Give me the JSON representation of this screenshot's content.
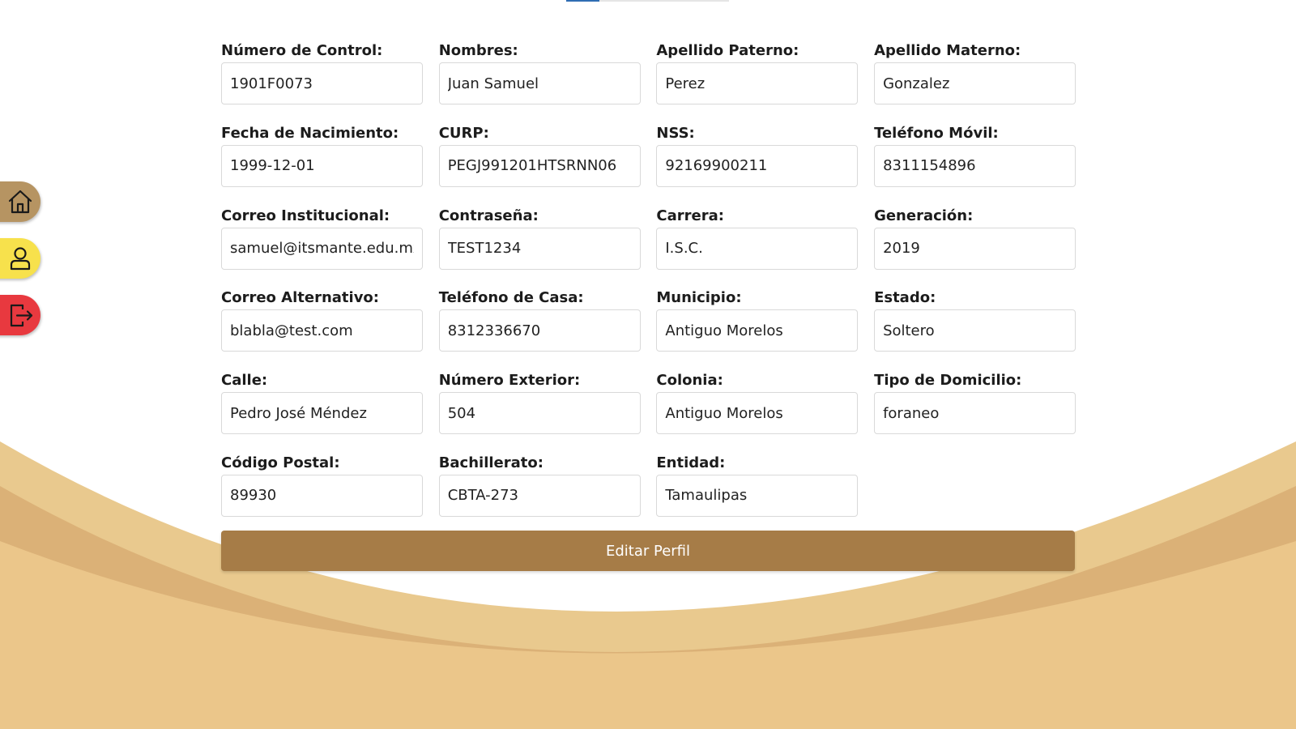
{
  "colors": {
    "wave_light": "#e9c98e",
    "wave_mid": "#dbb177",
    "wave_dark": "#ebc68a",
    "button": "#a67c47",
    "nav_home": "#b69462",
    "nav_profile": "#f7e14c",
    "nav_logout": "#e8393f",
    "tab_active": "#2f6db3"
  },
  "nav": {
    "home_icon": "home-icon",
    "profile_icon": "user-icon",
    "logout_icon": "logout-icon"
  },
  "fields": [
    {
      "label": "Número de Control:",
      "value": "1901F0073"
    },
    {
      "label": "Nombres:",
      "value": "Juan Samuel"
    },
    {
      "label": "Apellido Paterno:",
      "value": "Perez"
    },
    {
      "label": "Apellido Materno:",
      "value": "Gonzalez"
    },
    {
      "label": "Fecha de Nacimiento:",
      "value": "1999-12-01"
    },
    {
      "label": "CURP:",
      "value": "PEGJ991201HTSRNN06"
    },
    {
      "label": "NSS:",
      "value": "92169900211"
    },
    {
      "label": "Teléfono Móvil:",
      "value": "8311154896"
    },
    {
      "label": "Correo Institucional:",
      "value": "samuel@itsmante.edu.mx"
    },
    {
      "label": "Contraseña:",
      "value": "TEST1234"
    },
    {
      "label": "Carrera:",
      "value": "I.S.C."
    },
    {
      "label": "Generación:",
      "value": "2019"
    },
    {
      "label": "Correo Alternativo:",
      "value": "blabla@test.com"
    },
    {
      "label": "Teléfono de Casa:",
      "value": "8312336670"
    },
    {
      "label": "Municipio:",
      "value": "Antiguo Morelos"
    },
    {
      "label": "Estado:",
      "value": "Soltero"
    },
    {
      "label": "Calle:",
      "value": "Pedro José Méndez"
    },
    {
      "label": "Número Exterior:",
      "value": "504"
    },
    {
      "label": "Colonia:",
      "value": "Antiguo Morelos"
    },
    {
      "label": "Tipo de Domicilio:",
      "value": "foraneo"
    },
    {
      "label": "Código Postal:",
      "value": "89930"
    },
    {
      "label": "Bachillerato:",
      "value": "CBTA-273"
    },
    {
      "label": "Entidad:",
      "value": "Tamaulipas"
    }
  ],
  "actions": {
    "edit_label": "Editar Perfil"
  }
}
